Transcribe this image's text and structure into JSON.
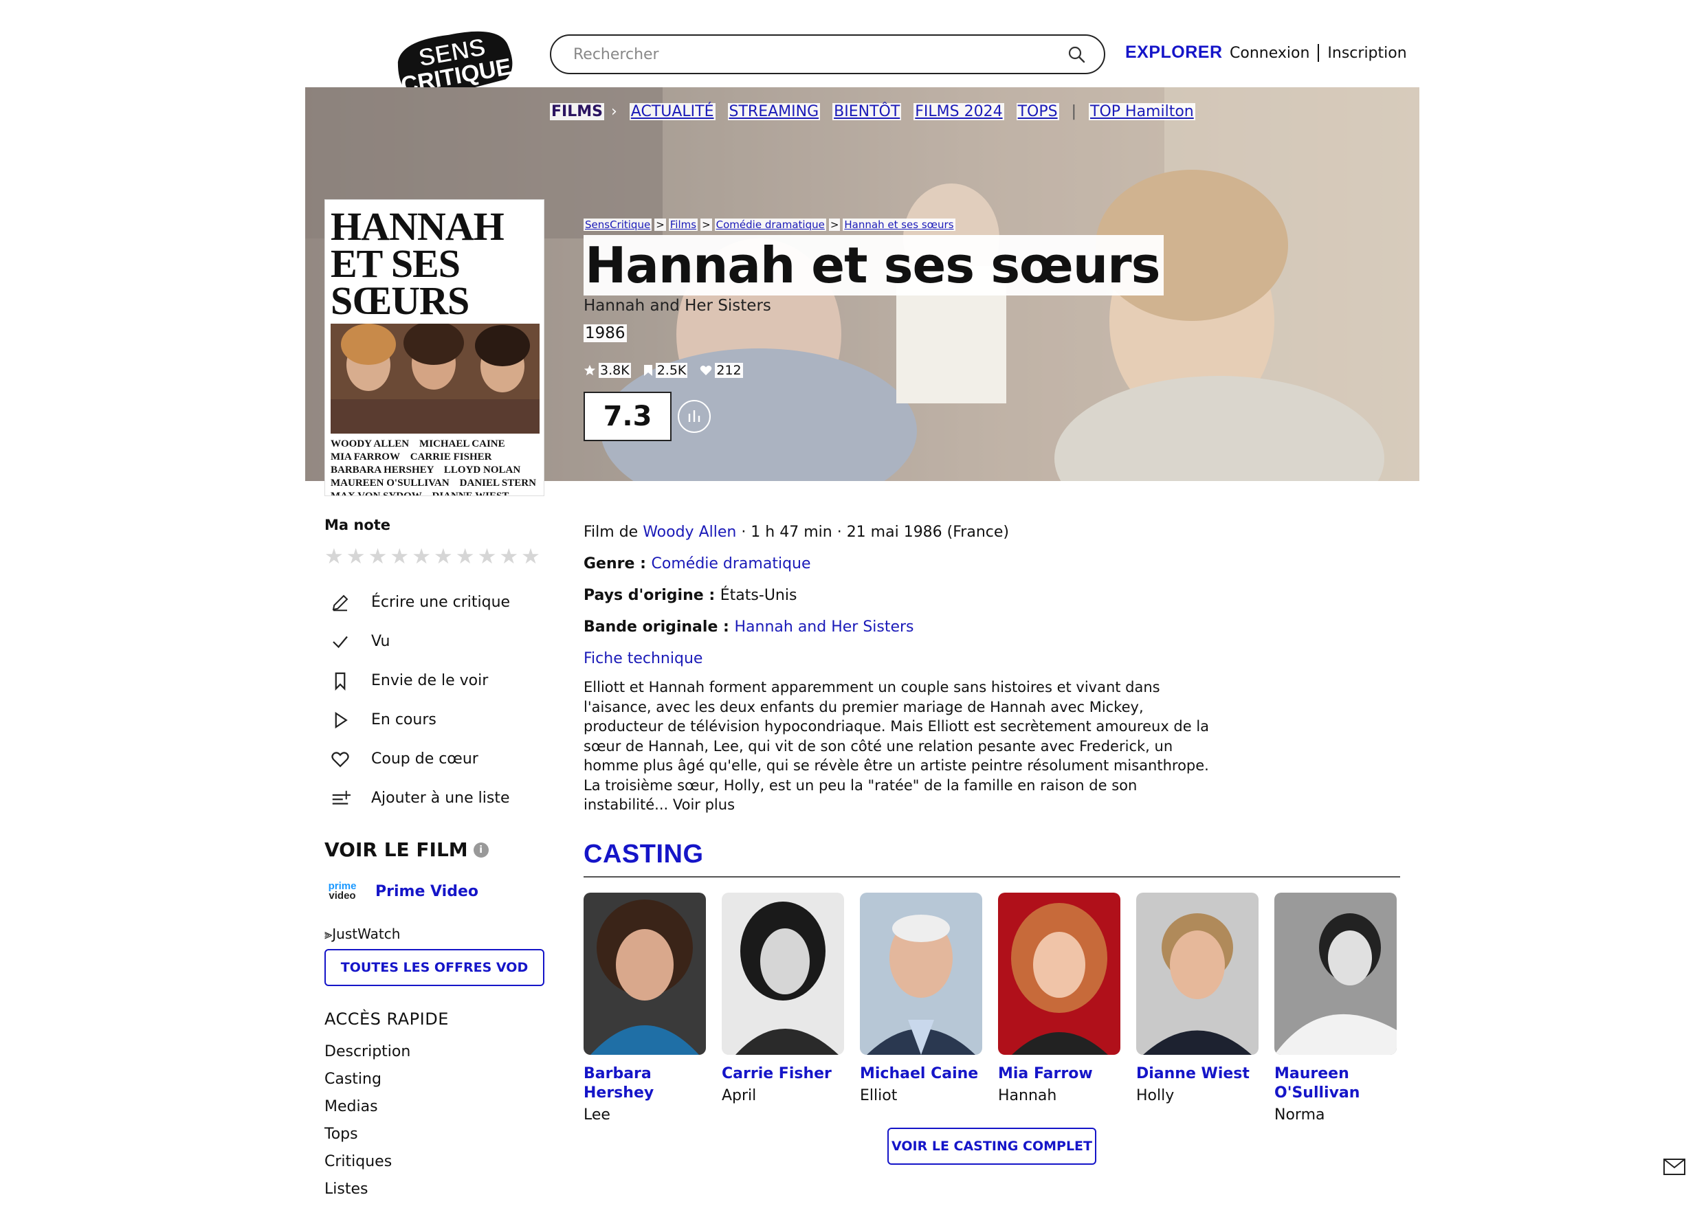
{
  "header": {
    "logo_text": "SENS CRITIQUE",
    "search_placeholder": "Rechercher",
    "explorer_label": "EXPLORER",
    "login_label": "Connexion",
    "signup_label": "Inscription"
  },
  "nav": {
    "items": [
      "FILMS",
      "ACTUALITÉ",
      "STREAMING",
      "BIENTÔT",
      "FILMS 2024",
      "TOPS",
      "TOP Hamilton"
    ]
  },
  "breadcrumb": [
    "SensCritique",
    "Films",
    "Comédie dramatique",
    "Hannah et ses sœurs"
  ],
  "movie": {
    "title": "Hannah et ses sœurs",
    "original_title": "Hannah and Her Sisters",
    "year": "1986",
    "ratings_count": "3.8K",
    "want_count": "2.5K",
    "likes_count": "212",
    "score": "7.3",
    "poster_title": "HANNAH ET SES SŒURS",
    "poster_cast": "WOODY ALLEN    MICHAEL CAINE\nMIA FARROW    CARRIE FISHER\nBARBARA HERSHEY    LLOYD NOLAN\nMAUREEN O'SULLIVAN    DANIEL STERN\nMAX VON SYDOW    DIANNE WIEST"
  },
  "left": {
    "my_rating_label": "Ma note",
    "actions": [
      "Écrire une critique",
      "Vu",
      "Envie de le voir",
      "En cours",
      "Coup de cœur",
      "Ajouter à une liste"
    ],
    "watch_title": "VOIR LE FILM",
    "provider_logo_top": "prime",
    "provider_logo_bottom": "video",
    "provider_name": "Prime Video",
    "justwatch": "JustWatch",
    "vod_button": "TOUTES LES OFFRES VOD",
    "quick_access_title": "ACCÈS RAPIDE",
    "quick_links": [
      "Description",
      "Casting",
      "Medias",
      "Tops",
      "Critiques",
      "Listes"
    ]
  },
  "details": {
    "film_by_prefix": "Film de ",
    "director": "Woody Allen",
    "film_meta": " · 1 h 47 min · 21 mai 1986 (France)",
    "genre_label": "Genre : ",
    "genre": "Comédie dramatique",
    "country_label": "Pays d'origine : ",
    "country": "États-Unis",
    "soundtrack_label": "Bande originale : ",
    "soundtrack": "Hannah and Her Sisters",
    "tech_sheet": "Fiche technique",
    "synopsis": "Elliott et Hannah forment apparemment un couple sans histoires et vivant dans l'aisance, avec les deux enfants du premier mariage de Hannah avec Mickey, producteur de télévision hypocondriaque. Mais Elliott est secrètement amoureux de la sœur de Hannah, Lee, qui vit de son côté une relation pesante avec Frederick, un homme plus âgé qu'elle, qui se révèle être un artiste peintre résolument misanthrope. La troisième sœur, Holly, est un peu la \"ratée\" de la famille en raison de son instabilité... Voir plus"
  },
  "casting": {
    "title": "CASTING",
    "full_cast_button": "VOIR LE CASTING COMPLET",
    "members": [
      {
        "name": "Barbara Hershey",
        "role": "Lee"
      },
      {
        "name": "Carrie Fisher",
        "role": "April"
      },
      {
        "name": "Michael Caine",
        "role": "Elliot"
      },
      {
        "name": "Mia Farrow",
        "role": "Hannah"
      },
      {
        "name": "Dianne Wiest",
        "role": "Holly"
      },
      {
        "name": "Maureen O'Sullivan",
        "role": "Norma"
      }
    ]
  },
  "colors": {
    "accent": "#1515c8",
    "link": "#1a1ab8",
    "star_empty": "#d6d6d6"
  }
}
